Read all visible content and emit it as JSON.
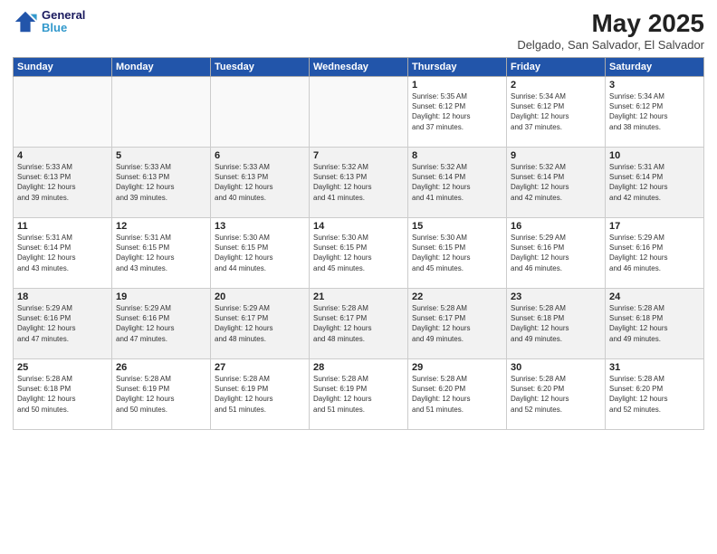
{
  "header": {
    "logo_line1": "General",
    "logo_line2": "Blue",
    "month_year": "May 2025",
    "location": "Delgado, San Salvador, El Salvador"
  },
  "days_of_week": [
    "Sunday",
    "Monday",
    "Tuesday",
    "Wednesday",
    "Thursday",
    "Friday",
    "Saturday"
  ],
  "weeks": [
    [
      {
        "day": "",
        "info": ""
      },
      {
        "day": "",
        "info": ""
      },
      {
        "day": "",
        "info": ""
      },
      {
        "day": "",
        "info": ""
      },
      {
        "day": "1",
        "info": "Sunrise: 5:35 AM\nSunset: 6:12 PM\nDaylight: 12 hours\nand 37 minutes."
      },
      {
        "day": "2",
        "info": "Sunrise: 5:34 AM\nSunset: 6:12 PM\nDaylight: 12 hours\nand 37 minutes."
      },
      {
        "day": "3",
        "info": "Sunrise: 5:34 AM\nSunset: 6:12 PM\nDaylight: 12 hours\nand 38 minutes."
      }
    ],
    [
      {
        "day": "4",
        "info": "Sunrise: 5:33 AM\nSunset: 6:13 PM\nDaylight: 12 hours\nand 39 minutes."
      },
      {
        "day": "5",
        "info": "Sunrise: 5:33 AM\nSunset: 6:13 PM\nDaylight: 12 hours\nand 39 minutes."
      },
      {
        "day": "6",
        "info": "Sunrise: 5:33 AM\nSunset: 6:13 PM\nDaylight: 12 hours\nand 40 minutes."
      },
      {
        "day": "7",
        "info": "Sunrise: 5:32 AM\nSunset: 6:13 PM\nDaylight: 12 hours\nand 41 minutes."
      },
      {
        "day": "8",
        "info": "Sunrise: 5:32 AM\nSunset: 6:14 PM\nDaylight: 12 hours\nand 41 minutes."
      },
      {
        "day": "9",
        "info": "Sunrise: 5:32 AM\nSunset: 6:14 PM\nDaylight: 12 hours\nand 42 minutes."
      },
      {
        "day": "10",
        "info": "Sunrise: 5:31 AM\nSunset: 6:14 PM\nDaylight: 12 hours\nand 42 minutes."
      }
    ],
    [
      {
        "day": "11",
        "info": "Sunrise: 5:31 AM\nSunset: 6:14 PM\nDaylight: 12 hours\nand 43 minutes."
      },
      {
        "day": "12",
        "info": "Sunrise: 5:31 AM\nSunset: 6:15 PM\nDaylight: 12 hours\nand 43 minutes."
      },
      {
        "day": "13",
        "info": "Sunrise: 5:30 AM\nSunset: 6:15 PM\nDaylight: 12 hours\nand 44 minutes."
      },
      {
        "day": "14",
        "info": "Sunrise: 5:30 AM\nSunset: 6:15 PM\nDaylight: 12 hours\nand 45 minutes."
      },
      {
        "day": "15",
        "info": "Sunrise: 5:30 AM\nSunset: 6:15 PM\nDaylight: 12 hours\nand 45 minutes."
      },
      {
        "day": "16",
        "info": "Sunrise: 5:29 AM\nSunset: 6:16 PM\nDaylight: 12 hours\nand 46 minutes."
      },
      {
        "day": "17",
        "info": "Sunrise: 5:29 AM\nSunset: 6:16 PM\nDaylight: 12 hours\nand 46 minutes."
      }
    ],
    [
      {
        "day": "18",
        "info": "Sunrise: 5:29 AM\nSunset: 6:16 PM\nDaylight: 12 hours\nand 47 minutes."
      },
      {
        "day": "19",
        "info": "Sunrise: 5:29 AM\nSunset: 6:16 PM\nDaylight: 12 hours\nand 47 minutes."
      },
      {
        "day": "20",
        "info": "Sunrise: 5:29 AM\nSunset: 6:17 PM\nDaylight: 12 hours\nand 48 minutes."
      },
      {
        "day": "21",
        "info": "Sunrise: 5:28 AM\nSunset: 6:17 PM\nDaylight: 12 hours\nand 48 minutes."
      },
      {
        "day": "22",
        "info": "Sunrise: 5:28 AM\nSunset: 6:17 PM\nDaylight: 12 hours\nand 49 minutes."
      },
      {
        "day": "23",
        "info": "Sunrise: 5:28 AM\nSunset: 6:18 PM\nDaylight: 12 hours\nand 49 minutes."
      },
      {
        "day": "24",
        "info": "Sunrise: 5:28 AM\nSunset: 6:18 PM\nDaylight: 12 hours\nand 49 minutes."
      }
    ],
    [
      {
        "day": "25",
        "info": "Sunrise: 5:28 AM\nSunset: 6:18 PM\nDaylight: 12 hours\nand 50 minutes."
      },
      {
        "day": "26",
        "info": "Sunrise: 5:28 AM\nSunset: 6:19 PM\nDaylight: 12 hours\nand 50 minutes."
      },
      {
        "day": "27",
        "info": "Sunrise: 5:28 AM\nSunset: 6:19 PM\nDaylight: 12 hours\nand 51 minutes."
      },
      {
        "day": "28",
        "info": "Sunrise: 5:28 AM\nSunset: 6:19 PM\nDaylight: 12 hours\nand 51 minutes."
      },
      {
        "day": "29",
        "info": "Sunrise: 5:28 AM\nSunset: 6:20 PM\nDaylight: 12 hours\nand 51 minutes."
      },
      {
        "day": "30",
        "info": "Sunrise: 5:28 AM\nSunset: 6:20 PM\nDaylight: 12 hours\nand 52 minutes."
      },
      {
        "day": "31",
        "info": "Sunrise: 5:28 AM\nSunset: 6:20 PM\nDaylight: 12 hours\nand 52 minutes."
      }
    ]
  ]
}
